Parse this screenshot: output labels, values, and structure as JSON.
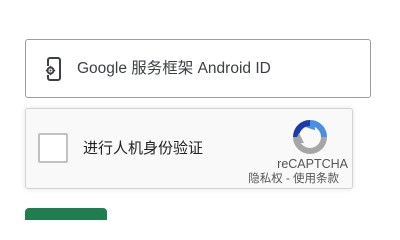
{
  "device_field": {
    "icon": "phone-gear-icon",
    "label": "Google 服务框架 Android ID"
  },
  "recaptcha": {
    "checkbox_label": "进行人机身份验证",
    "brand": "reCAPTCHA",
    "privacy_link": "隐私权",
    "separator": " - ",
    "terms_link": "使用条款",
    "logo_icon": "recaptcha-logo-icon"
  },
  "colors": {
    "field_border": "#9e9e9e",
    "recaptcha_bg": "#f9f9f9",
    "recaptcha_blue": "#4a90e2",
    "recaptcha_gray": "#a6a6a6",
    "recaptcha_dark_blue": "#1c3aa9",
    "button_green": "#1e7e4e"
  }
}
